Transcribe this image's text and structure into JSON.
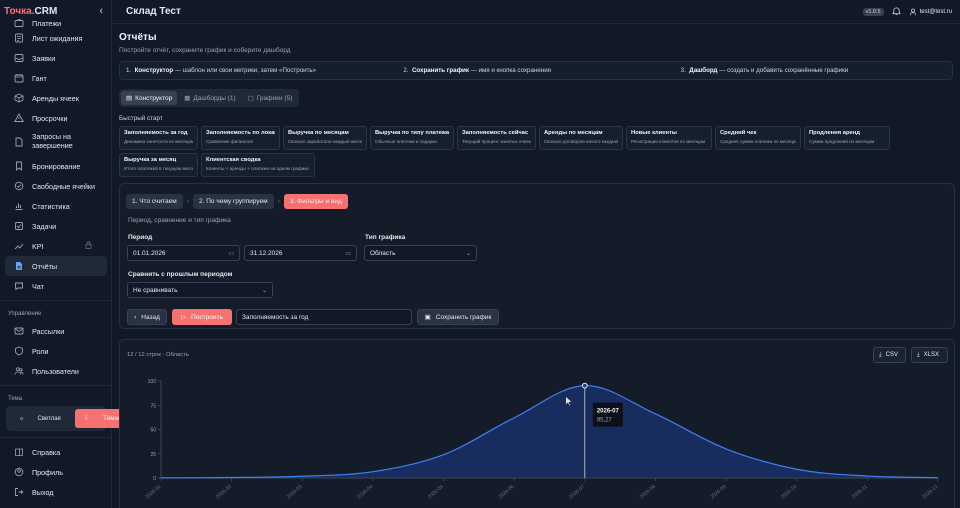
{
  "brand": {
    "part1": "Точка.",
    "part2": "CRM"
  },
  "sidebar": {
    "items": [
      {
        "label": "Платежи",
        "icon": "wallet-icon"
      },
      {
        "label": "Лист ожидания",
        "icon": "list-icon"
      },
      {
        "label": "Заявки",
        "icon": "inbox-icon"
      },
      {
        "label": "Гант",
        "icon": "calendar-icon"
      },
      {
        "label": "Аренды ячеек",
        "icon": "box-icon"
      },
      {
        "label": "Просрочки",
        "icon": "alert-icon"
      },
      {
        "label": "Запросы на завершение",
        "icon": "file-icon"
      },
      {
        "label": "Бронирование",
        "icon": "bookmark-icon"
      },
      {
        "label": "Свободные ячейки",
        "icon": "circle-check-icon"
      },
      {
        "label": "Статистика",
        "icon": "chart-icon"
      },
      {
        "label": "Задачи",
        "icon": "task-icon"
      },
      {
        "label": "KPI",
        "icon": "kpi-icon"
      },
      {
        "label": "Отчёты",
        "icon": "report-icon"
      },
      {
        "label": "Чат",
        "icon": "chat-icon"
      }
    ],
    "mgmt_label": "Управление",
    "mgmt_items": [
      {
        "label": "Рассылки",
        "icon": "mail-icon"
      },
      {
        "label": "Роли",
        "icon": "shield-icon"
      },
      {
        "label": "Пользователи",
        "icon": "users-icon"
      }
    ],
    "theme_label": "Тема",
    "theme_light": "Светлая",
    "theme_dark": "Тёмная",
    "bottom_items": [
      {
        "label": "Справка",
        "icon": "help-icon"
      },
      {
        "label": "Профиль",
        "icon": "profile-icon"
      },
      {
        "label": "Выход",
        "icon": "logout-icon"
      }
    ]
  },
  "topbar": {
    "title": "Склад Тест",
    "version": "v1.0.5",
    "user": "test@test.ru"
  },
  "page": {
    "title": "Отчёты",
    "subtitle": "Постройте отчёт, сохраните график и соберите дашборд",
    "steps": [
      {
        "num": "1.",
        "bold": "Конструктор",
        "rest": " — шаблон или свои метрики, затем «Построить»"
      },
      {
        "num": "2.",
        "bold": "Сохранить график",
        "rest": " — имя и кнопка сохранения"
      },
      {
        "num": "3.",
        "bold": "Дашборд",
        "rest": " — создать и добавить сохранённые графики"
      }
    ],
    "tabs": [
      {
        "label": "Конструктор"
      },
      {
        "label": "Дашборды (1)"
      },
      {
        "label": "Графики (5)"
      }
    ],
    "quick_label": "Быстрый старт",
    "quick": [
      {
        "title": "Заполняемость за год",
        "desc": "Динамика занятости по месяцам"
      },
      {
        "title": "Заполняемость по локациям",
        "desc": "Сравнение филиалов"
      },
      {
        "title": "Выручка по месяцам",
        "desc": "Сколько заработали каждый месяц"
      },
      {
        "title": "Выручка по типу платежа",
        "desc": "Обычные платежи и подарки"
      },
      {
        "title": "Заполняемость сейчас",
        "desc": "Текущий процент занятых ячеек"
      },
      {
        "title": "Аренды по месяцам",
        "desc": "Сколько договоров начато каждый месяц"
      },
      {
        "title": "Новые клиенты",
        "desc": "Регистрации клиентов по месяцам"
      },
      {
        "title": "Средний чек",
        "desc": "Средняя сумма платежа по месяцам"
      },
      {
        "title": "Продления аренд",
        "desc": "Сумма продлений по месяцам"
      },
      {
        "title": "Выручка за месяц",
        "desc": "Итого платежей в текущем месяце"
      },
      {
        "title": "Клиентская сводка",
        "desc": "Клиенты + аренды + платежи на одном графике"
      }
    ]
  },
  "builder": {
    "steps": [
      "1. Что считаем",
      "2. По чему группируем",
      "3. Фильтры и вид"
    ],
    "desc": "Период, сравнение и тип графика",
    "period_label": "Период",
    "date_from": "01.01.2026",
    "date_to": "31.12.2026",
    "chart_type_label": "Тип графика",
    "chart_type": "Область",
    "compare_label": "Сравнить с прошлым периодом",
    "compare_value": "Не сравнивать",
    "back": "Назад",
    "build": "Построить",
    "name_value": "Заполняемость за год",
    "save": "Сохранить график"
  },
  "result": {
    "meta_rows": "12 / 12 строк",
    "meta_type": "Область",
    "csv": "CSV",
    "xlsx": "XLSX",
    "tooltip_label": "2026-07",
    "tooltip_value": "95,27"
  },
  "chart_data": {
    "type": "area",
    "x": [
      "2026-01",
      "2026-02",
      "2026-03",
      "2026-04",
      "2026-05",
      "2026-06",
      "2026-07",
      "2026-08",
      "2026-09",
      "2026-10",
      "2026-11",
      "2026-12"
    ],
    "series": [
      {
        "values": [
          0.1,
          0.5,
          1.8,
          6.5,
          24,
          62,
          95.27,
          66,
          30,
          9,
          2,
          0.3
        ]
      }
    ],
    "yticks": [
      0,
      25,
      50,
      75,
      100
    ],
    "ylim": [
      0,
      100
    ],
    "color": "#3b82f6",
    "highlight_index": 6
  }
}
